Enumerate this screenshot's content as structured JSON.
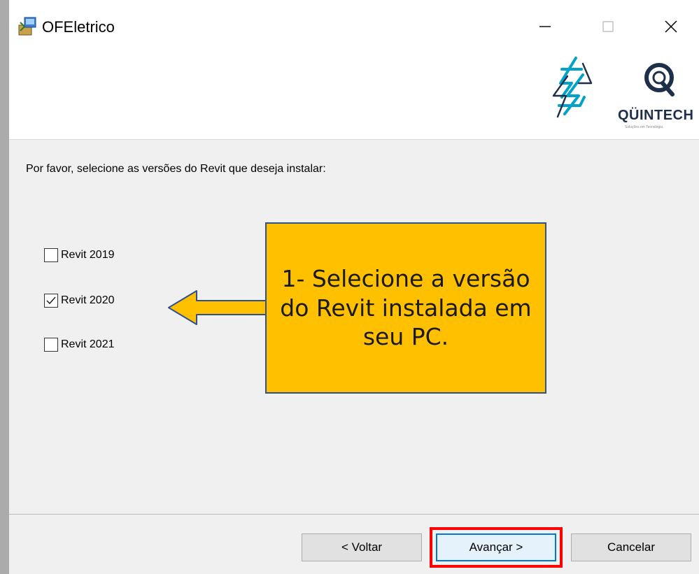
{
  "window": {
    "title": "OFEletrico",
    "icons": {
      "app": "installer-icon",
      "minimize": "minimize-icon",
      "maximize": "maximize-icon",
      "close": "close-icon"
    }
  },
  "header": {
    "brand_name": "QÜINTECH",
    "brand_tagline": "Soluções em Tecnologia",
    "icons": {
      "product_logo": "lightning-bolt-logo-icon",
      "brand_logo": "q-logo-icon"
    }
  },
  "content": {
    "prompt": "Por favor, selecione as versões do Revit que deseja instalar:",
    "options": [
      {
        "label": "Revit 2019",
        "checked": false
      },
      {
        "label": "Revit 2020",
        "checked": true
      },
      {
        "label": "Revit 2021",
        "checked": false
      }
    ]
  },
  "annotation": {
    "text": "1- Selecione a versão do Revit instalada em seu PC.",
    "fill_color": "#ffc000",
    "border_color": "#2f528f",
    "highlight_color": "#ff0000"
  },
  "footer": {
    "back_label": "< Voltar",
    "next_label": "Avançar >",
    "cancel_label": "Cancelar"
  }
}
